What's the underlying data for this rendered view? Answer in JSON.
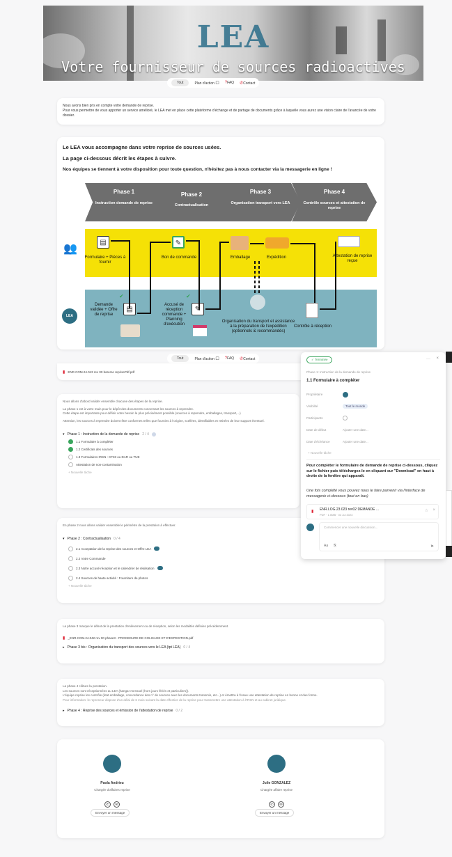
{
  "hero": {
    "logo": "LEA",
    "tagline": "Votre fournisseur de sources radioactives"
  },
  "nav": {
    "items": [
      "Tout",
      "Plan d'action",
      "FAQ",
      "Contact"
    ]
  },
  "intro": {
    "line1": "Nous avons bien pris en compte votre demande de reprise.",
    "line2": "Pour vous permettre de vous apporter un service amélioré, le LEA met en place cette plateforme d'échange et de partage de documents grâce à laquelle vous aurez une vision claire de l'avancée de votre dossier."
  },
  "guide": {
    "line1": "Le LEA vous accompagne dans votre reprise de sources usées.",
    "line2": "La page ci-dessous décrit les étapes à suivre.",
    "line3": "Nos équipes se tiennent à votre disposition pour toute question, n'hésitez pas à nous contacter via la messagerie en ligne !"
  },
  "diagram": {
    "phases": [
      {
        "title": "Phase 1",
        "sub": "Instruction demande de reprise"
      },
      {
        "title": "Phase 2",
        "sub": "Contractualisation"
      },
      {
        "title": "Phase 3",
        "sub": "Organisation transport vers LEA"
      },
      {
        "title": "Phase 4",
        "sub": "Contrôle sources et attestation de reprise"
      }
    ],
    "client_steps": {
      "formulaire": "Formulaire + Pièces à fournir",
      "bon": "Bon de commande",
      "emballage": "Emballage",
      "expedition": "Expédition",
      "attestation": "Attestation de reprise reçue"
    },
    "lea_steps": {
      "demande": "Demande validée + Offre de reprise",
      "accuse": "Accusé de réception commande + Planning d'exécution",
      "organisation": "Organisation du transport et assistance à la préparation de l'expédition (optionnels & recommandés)",
      "controle": "Contrôle à réception"
    },
    "lea_badge": "LEA"
  },
  "phase1_card": {
    "file": "ENR.COM.24.043 rev 00 bareme reprisePdf.pdf",
    "text1": "Nous allons d'abord valider ensemble chacune des étapes de la reprise.",
    "text2": "La phase 1 est à votre main pour le dépôt des documents concernant les sources à reprendre.",
    "text3": "Cette étape est importante pour définir votre besoin le plus précisément possible (sources à reprendre, emballages, transport,...)",
    "text4": "Attention, les sources à reprendre doivent être conformes telles que fournies à l'origine, scellées, identifiables et retirées de leur support éventuel.",
    "group": "Phase 1 : Instruction de la demande de reprise",
    "count": "2 / 4",
    "tasks": [
      {
        "label": "1.1 Formulaire à compléter",
        "done": true
      },
      {
        "label": "1.2 Certificats des sources",
        "done": true
      },
      {
        "label": "1.3 Formulaires IRSN : CF33 ou DAR ou TUE",
        "done": false
      },
      {
        "label": "Attestation de non-contamination",
        "done": false
      }
    ],
    "add": "+ Nouvelle tâche"
  },
  "phase2_card": {
    "text": "En phase 2 nous allons valider ensemble le périmètre de la prestation à effectuer.",
    "group": "Phase 2 : Contractualisation",
    "count": "0 / 4",
    "tasks": [
      "2.1 Acceptation de la reprise des sources et Offre LEA",
      "2.2 Votre Commande",
      "2.3 Notre accusé réception et le calendrier de réalisation",
      "2.4 Sources de haute activité : Fourniture de photos"
    ],
    "add": "+ Nouvelle tâche"
  },
  "phase3_card": {
    "text": "La phase 3 marque le début de la prestation d'enlèvement ou de réception, selon les modalités définies précédemment.",
    "file": "_ENR.COM.24.042 rev 00 phase3 - PROCEDURE DE COLISAGE ET D'EXPEDITION.pdf",
    "group": "Phase 3 bis : Organisation du transport des sources vers le LEA (tpt LEA)",
    "count": "0 / 4"
  },
  "phase4_card": {
    "text1": "La phase 4 clôture la prestation.",
    "text2": "Les sources sont réceptionnées au LEA (hangar mensuel (hors jours fériés et particuliers)).",
    "text3": "L'équipe reprise les contrôle (état emballage, concordance des n° de sources avec les documents transmis, etc...) et émettra à l'issue une attestation de reprise en bonne et due forme.",
    "text4": "Pour information: le repreneur dispose d'un délai de 6 mois suivant la date effective de la reprise pour transmettre une attestation à l'IRSN et au cabinet juridique.",
    "group": "Phase 4 : Reprise des sources et émission de l'attestation de reprise",
    "count": "0 / 2"
  },
  "contacts": [
    {
      "name": "Paola Andrieu",
      "role": "Chargée d'affaires reprise",
      "msg": "Envoyer un message"
    },
    {
      "name": "Julie GONZALEZ",
      "role": "Chargée affaire reprise",
      "msg": "Envoyer un message"
    }
  ],
  "panel": {
    "status": "✓ Terminée",
    "breadcrumb": "Phase 1: Instruction de la demande de reprise",
    "title": "1.1 Formulaire à compléter",
    "fields": [
      {
        "label": "Propriétaire",
        "value": ""
      },
      {
        "label": "Visibilité",
        "value": "Tout le monde"
      },
      {
        "label": "Participants",
        "value": ""
      },
      {
        "label": "Date de début",
        "value": "Ajouter une date..."
      },
      {
        "label": "Date d'échéance",
        "value": "Ajouter une date..."
      }
    ],
    "subtask": "+ Nouvelle tâche",
    "desc1": "Pour compléter le formulaire de demande de reprise ci-dessous, cliquez sur le fichier puis téléchargez-le en cliquant sur \"Download\" en haut à droite de la fenêtre qui apparaît.",
    "desc2": "Une fois complété vous pouvez nous le faire parvenir via l'interface de messagerie ci-dessous (tout en bas)",
    "file": "ENR.LOG.23.023 rev02 DEMANDE ...",
    "file_meta": "PDF · 1.0MB · 04 Jul 2023",
    "comment_placeholder": "Commencer une nouvelle discussion...",
    "font_label": "Aa"
  }
}
